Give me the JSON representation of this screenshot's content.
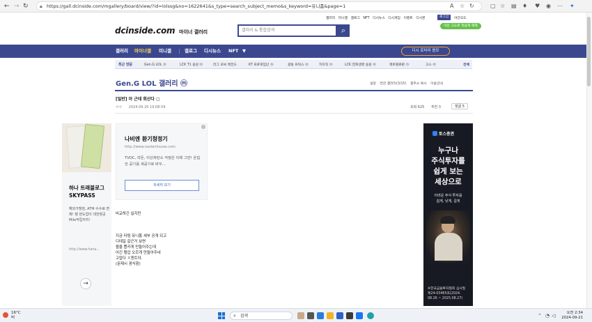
{
  "browser": {
    "url": "https://gall.dcinside.com/mgallery/board/view/?id=lolssg&no=1622641&s_type=search_subject_memo&s_keyword=유니폼&page=1",
    "back_icon": "back-arrow-icon",
    "forward_icon": "forward-arrow-icon",
    "refresh_icon": "refresh-icon",
    "home_icon": "home-icon"
  },
  "topnav": {
    "items": [
      "갤러리",
      "미니갤",
      "갤로그",
      "NFT",
      "디시뉴스",
      "디시게임",
      "이벤트",
      "디시콘"
    ],
    "login": "로그인",
    "darkmode": "야간모드",
    "promo": "이런 고도로 적응해 해해"
  },
  "logo": {
    "main": "dcinside.com",
    "sub": "마이너 갤러리"
  },
  "search": {
    "placeholder": "갤러리 & 통합검색"
  },
  "navbar": {
    "items": [
      "갤러리",
      "마이너갤",
      "미니갤",
      "갤로그",
      "디시뉴스",
      "NFT",
      "▼"
    ],
    "rotation": "디시 로터리 응모"
  },
  "recent": {
    "label": "최근 방문",
    "items": [
      "Gen.G LOL ⓜ",
      "LCK T1 응원 ⓜ",
      "리그 오브 레전드",
      "KT 프로게임단 ⓜ",
      "광동 프릭스 ⓜ",
      "치지직 ⓜ",
      "LCK 한화생명 응원 ⓜ",
      "제트텔로판 ⓜ",
      "고스 ⓜ"
    ],
    "all": "전체"
  },
  "gallery": {
    "title": "Gen.G LOL 갤러리 ⓜ",
    "tools": [
      "설정",
      "연관 갤러리(3/15)",
      "갤주소 복사",
      "이용안내"
    ]
  },
  "post": {
    "title": "[일반] 아 근데 회산다 ▢",
    "author": "ㅇㅇ",
    "date": "2024.09.20 19:08:59",
    "views": "조회 625",
    "recommend": "추천 3",
    "comments": "댓글 5",
    "body_line1": "비교하긴 실지만",
    "body_rest": "지금 타팀 유니폼 세부 공개 되고\n디테일 갈곤거 보면\n퀄을 뽑카게 만들어주는데\n어긴 혈압 오르게 만들어주네\n고맙다 ㅈ젠트야.\n(문제시 광식함)"
  },
  "ad_left": {
    "title": "하나 트래블로그SKYPASS",
    "desc": "해외가맹점, ATM 수수료 면제! 쉘 현도업이 대한항공 Mile적립까지!",
    "url": "http://www.hana...",
    "arrow": "→"
  },
  "ad_center": {
    "title": "나비엔 환기청정기",
    "url": "http://www.navienhouse.com",
    "desc": "TVOC, 라돈, 이산화탄소 걱정은 이제 그만! 온집안 공기를 새공기로 바꾸...",
    "button": "자세히 보기"
  },
  "ad_right": {
    "brand": "토스증권",
    "headline": "누구나\n주식투자를\n쉽게 보는\n세상으로",
    "sub": "어려운 주식 투자를\n쉽게, 낮게, 길게",
    "footer": "※한국금융투자협회 심사필\n제24-03465호(2024.\n08.26 ~ 2025.08.27)"
  },
  "taskbar": {
    "temp": "16°C",
    "weather": "비",
    "search": "검색",
    "time": "오전 2:34",
    "date": "2024-09-21"
  }
}
